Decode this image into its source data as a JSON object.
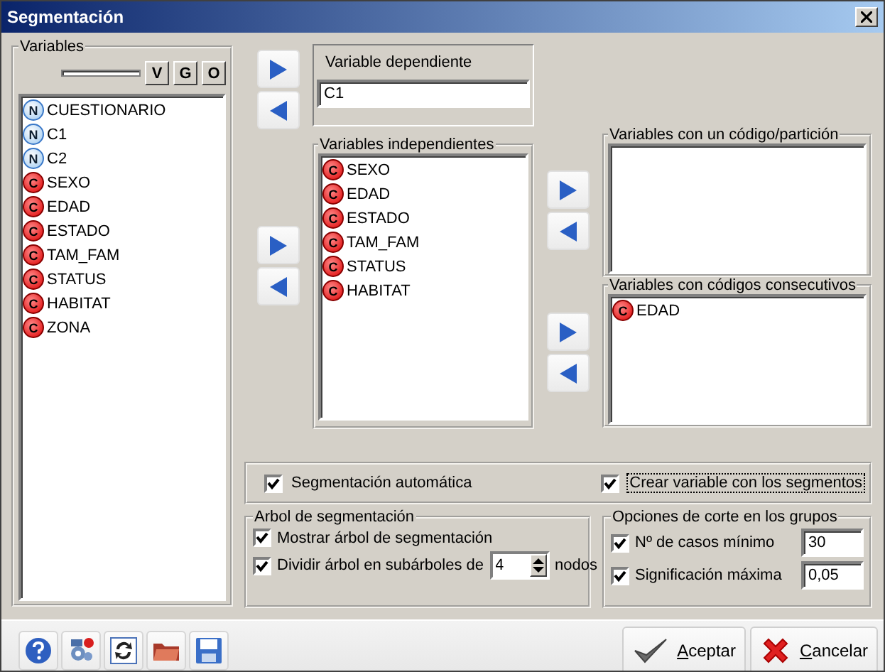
{
  "window": {
    "title": "Segmentación"
  },
  "variables": {
    "title": "Variables",
    "filter_buttons": [
      "V",
      "G",
      "O"
    ],
    "items": [
      {
        "name": "CUESTIONARIO",
        "kind": "numeric",
        "badge": "N"
      },
      {
        "name": "C1",
        "kind": "numeric",
        "badge": "N"
      },
      {
        "name": "C2",
        "kind": "numeric",
        "badge": "N"
      },
      {
        "name": "SEXO",
        "kind": "categorical",
        "badge": "C"
      },
      {
        "name": "EDAD",
        "kind": "categorical",
        "badge": "C"
      },
      {
        "name": "ESTADO",
        "kind": "categorical",
        "badge": "C"
      },
      {
        "name": "TAM_FAM",
        "kind": "categorical",
        "badge": "C"
      },
      {
        "name": "STATUS",
        "kind": "categorical",
        "badge": "C"
      },
      {
        "name": "HABITAT",
        "kind": "categorical",
        "badge": "C"
      },
      {
        "name": "ZONA",
        "kind": "categorical",
        "badge": "C"
      }
    ]
  },
  "dependent": {
    "title": "Variable dependiente",
    "value": "C1"
  },
  "independent": {
    "title": "Variables independientes",
    "items": [
      {
        "name": "SEXO",
        "kind": "categorical",
        "badge": "C"
      },
      {
        "name": "EDAD",
        "kind": "categorical",
        "badge": "C"
      },
      {
        "name": "ESTADO",
        "kind": "categorical",
        "badge": "C"
      },
      {
        "name": "TAM_FAM",
        "kind": "categorical",
        "badge": "C"
      },
      {
        "name": "STATUS",
        "kind": "categorical",
        "badge": "C"
      },
      {
        "name": "HABITAT",
        "kind": "categorical",
        "badge": "C"
      }
    ]
  },
  "single_code": {
    "title": "Variables con un código/partición"
  },
  "consecutive": {
    "title": "Variables con códigos consecutivos",
    "items": [
      {
        "name": "EDAD",
        "kind": "categorical",
        "badge": "C"
      }
    ]
  },
  "options": [
    {
      "label": "Segmentación automática",
      "checked": true,
      "focused": false
    },
    {
      "label": "Crear variable con los segmentos",
      "checked": true,
      "focused": true
    }
  ],
  "tree": {
    "title": "Arbol de segmentación",
    "show": {
      "label": "Mostrar árbol de segmentación",
      "checked": true
    },
    "split": {
      "label": "Dividir árbol en subárboles de",
      "checked": true,
      "value": "4",
      "unit": "nodos"
    }
  },
  "cut": {
    "title": "Opciones de corte en los grupos",
    "rows": [
      {
        "label": "Nº de casos mínimo",
        "checked": true,
        "value": "30"
      },
      {
        "label": "Significación máxima",
        "checked": true,
        "value": "0,05"
      }
    ]
  },
  "toolbar": [
    {
      "kind": "help"
    },
    {
      "kind": "settings"
    },
    {
      "kind": "refresh"
    },
    {
      "kind": "open"
    },
    {
      "kind": "save"
    }
  ],
  "buttons": [
    {
      "label": "Aceptar",
      "kind": "ok"
    },
    {
      "label": "Cancelar",
      "kind": "cancel"
    }
  ]
}
